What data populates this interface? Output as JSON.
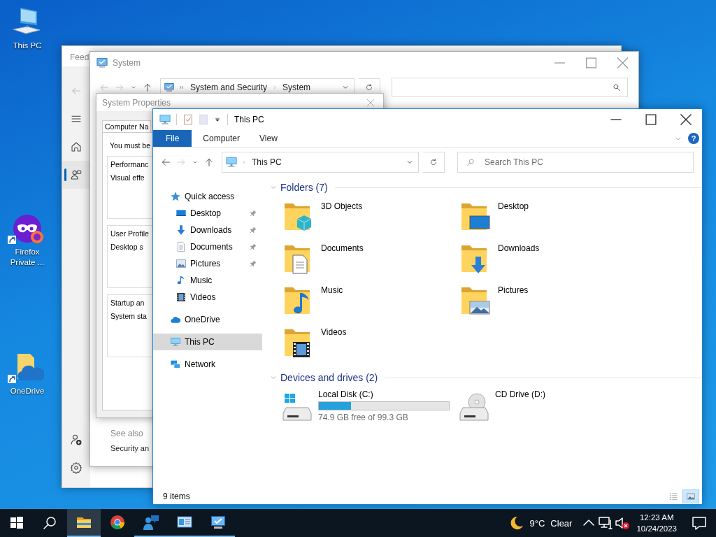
{
  "desktop_icons": [
    {
      "label": "This PC",
      "kind": "pc",
      "shortcut": false
    },
    {
      "label": "Firefox Private ...",
      "kind": "private",
      "shortcut": true
    },
    {
      "label": "OneDrive",
      "kind": "onedrive",
      "shortcut": true
    }
  ],
  "settings_window": {
    "title": "Feed",
    "toolbar": [
      {
        "kind": "back"
      },
      {
        "kind": "menu"
      }
    ],
    "nav_items": [
      {
        "kind": "home",
        "selected": false
      },
      {
        "kind": "accounts",
        "selected": true
      }
    ],
    "bottom_items": [
      {
        "kind": "add-user"
      },
      {
        "kind": "settings"
      }
    ]
  },
  "system_window": {
    "title": "System",
    "path": [
      "System and Security",
      "System"
    ],
    "see_also": "See also",
    "link": "Security an"
  },
  "system_properties": {
    "title": "System Properties",
    "tab": "Computer Na",
    "intro": "You must be",
    "groups": [
      {
        "title": "Performanc",
        "text": "Visual effe"
      },
      {
        "title": "User Profile",
        "text": "Desktop s"
      },
      {
        "title": "Startup an",
        "text": "System sta"
      }
    ]
  },
  "explorer": {
    "title": "This PC",
    "ribbon_tabs": [
      {
        "label": "File",
        "kind": "file"
      },
      {
        "label": "Computer",
        "kind": "tab"
      },
      {
        "label": "View",
        "kind": "tab"
      }
    ],
    "help_label": "?",
    "address": "This PC",
    "search_placeholder": "Search This PC",
    "nav": [
      {
        "label": "Quick access",
        "kind": "star",
        "selected": false,
        "children": [
          {
            "label": "Desktop",
            "kind": "desktop",
            "pinned": true,
            "selected": false
          },
          {
            "label": "Downloads",
            "kind": "downloads",
            "pinned": true,
            "selected": false
          },
          {
            "label": "Documents",
            "kind": "documents",
            "pinned": true,
            "selected": false
          },
          {
            "label": "Pictures",
            "kind": "pictures",
            "pinned": true,
            "selected": false
          },
          {
            "label": "Music",
            "kind": "music",
            "pinned": false,
            "selected": false
          },
          {
            "label": "Videos",
            "kind": "videos",
            "pinned": false,
            "selected": false
          }
        ]
      },
      {
        "label": "OneDrive",
        "kind": "cloud",
        "selected": false
      },
      {
        "label": "This PC",
        "kind": "pc",
        "selected": true
      },
      {
        "label": "Network",
        "kind": "network",
        "selected": false
      }
    ],
    "sections": [
      {
        "title": "Folders (7)",
        "expanded": true,
        "kind": "folders",
        "items": [
          {
            "label": "3D Objects",
            "kind": "objects"
          },
          {
            "label": "Desktop",
            "kind": "desktop"
          },
          {
            "label": "Documents",
            "kind": "documents"
          },
          {
            "label": "Downloads",
            "kind": "downloads"
          },
          {
            "label": "Music",
            "kind": "music"
          },
          {
            "label": "Pictures",
            "kind": "pictures"
          },
          {
            "label": "Videos",
            "kind": "videos"
          }
        ]
      },
      {
        "title": "Devices and drives (2)",
        "expanded": true,
        "kind": "drives",
        "items": [
          {
            "label": "Local Disk (C:)",
            "kind": "system",
            "level": 0.246,
            "free": "74.9 GB free of 99.3 GB"
          },
          {
            "label": "CD Drive (D:)",
            "kind": "cd"
          }
        ]
      }
    ],
    "status": "9 items",
    "view_modes": [
      {
        "kind": "details",
        "selected": false
      },
      {
        "kind": "tiles",
        "selected": true
      }
    ]
  },
  "taskbar": {
    "apps": [
      {
        "kind": "explorer",
        "active": true,
        "running": true
      },
      {
        "kind": "browser",
        "active": false,
        "running": false
      },
      {
        "kind": "people",
        "active": false,
        "running": true
      },
      {
        "kind": "control",
        "active": false,
        "running": true
      },
      {
        "kind": "system",
        "active": false,
        "running": true
      }
    ],
    "weather": {
      "temp": "9°C",
      "condition": "Clear"
    },
    "tray": [
      {
        "kind": "network"
      },
      {
        "kind": "volume-muted"
      }
    ],
    "clock": {
      "time": "12:23 AM",
      "date": "10/24/2023"
    }
  }
}
